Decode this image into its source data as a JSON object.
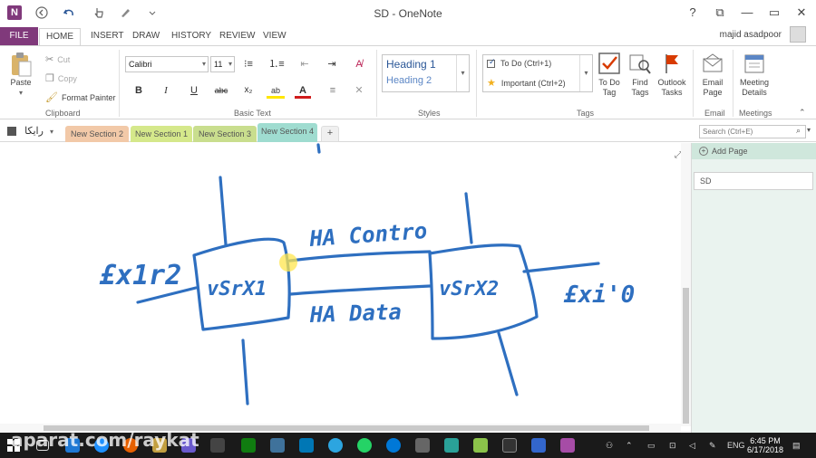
{
  "window": {
    "title": "SD - OneNote",
    "app_icon_letter": "N",
    "controls": {
      "help": "?",
      "restore": "⧉",
      "minimize": "—",
      "maximize": "▭",
      "close": "✕"
    }
  },
  "ribbon_tabs": [
    "FILE",
    "HOME",
    "INSERT",
    "DRAW",
    "HISTORY",
    "REVIEW",
    "VIEW"
  ],
  "user": {
    "name": "majid asadpoor"
  },
  "clipboard": {
    "paste": "Paste",
    "cut": "Cut",
    "copy": "Copy",
    "format_painter": "Format Painter",
    "group_label": "Clipboard"
  },
  "basic_text": {
    "font": "Calibri",
    "size": "11",
    "bold": "B",
    "italic": "I",
    "underline": "U",
    "strike": "abc",
    "subscript": "x₂",
    "highlight": "ab",
    "font_color": "A",
    "group_label": "Basic Text"
  },
  "styles": {
    "heading1": "Heading 1",
    "heading2": "Heading 2",
    "group_label": "Styles"
  },
  "tags": {
    "todo": "To Do (Ctrl+1)",
    "important": "Important (Ctrl+2)",
    "todo_tag": [
      "To Do",
      "Tag"
    ],
    "find_tags": [
      "Find",
      "Tags"
    ],
    "outlook_tasks": [
      "Outlook",
      "Tasks"
    ],
    "group_label": "Tags"
  },
  "email": {
    "label": [
      "Email",
      "Page"
    ],
    "group_label": "Email"
  },
  "meetings": {
    "label": [
      "Meeting",
      "Details"
    ],
    "group_label": "Meetings"
  },
  "notebook": {
    "name": "رایکا"
  },
  "sections": [
    {
      "label": "New Section 2",
      "color": "#f2c9a8"
    },
    {
      "label": "New Section 1",
      "color": "#d5e88b"
    },
    {
      "label": "New Section 3",
      "color": "#c9de8e"
    },
    {
      "label": "New Section 4",
      "color": "#9fdcd0"
    }
  ],
  "search": {
    "placeholder": "Search (Ctrl+E)"
  },
  "pages": {
    "add_page": "Add Page",
    "items": [
      "SD"
    ]
  },
  "ink_text": {
    "left_port": "£x1r2",
    "node1": "vSrX1",
    "ha_control": "HA Contro",
    "ha_data": "HA Data",
    "node2": "vSrX2",
    "right_port": "£xi'0"
  },
  "taskbar": {
    "watermark": "aparat.com/raykat",
    "language": "ENG",
    "time": "6:45 PM",
    "date": "6/17/2018",
    "accent": "#80397b"
  }
}
